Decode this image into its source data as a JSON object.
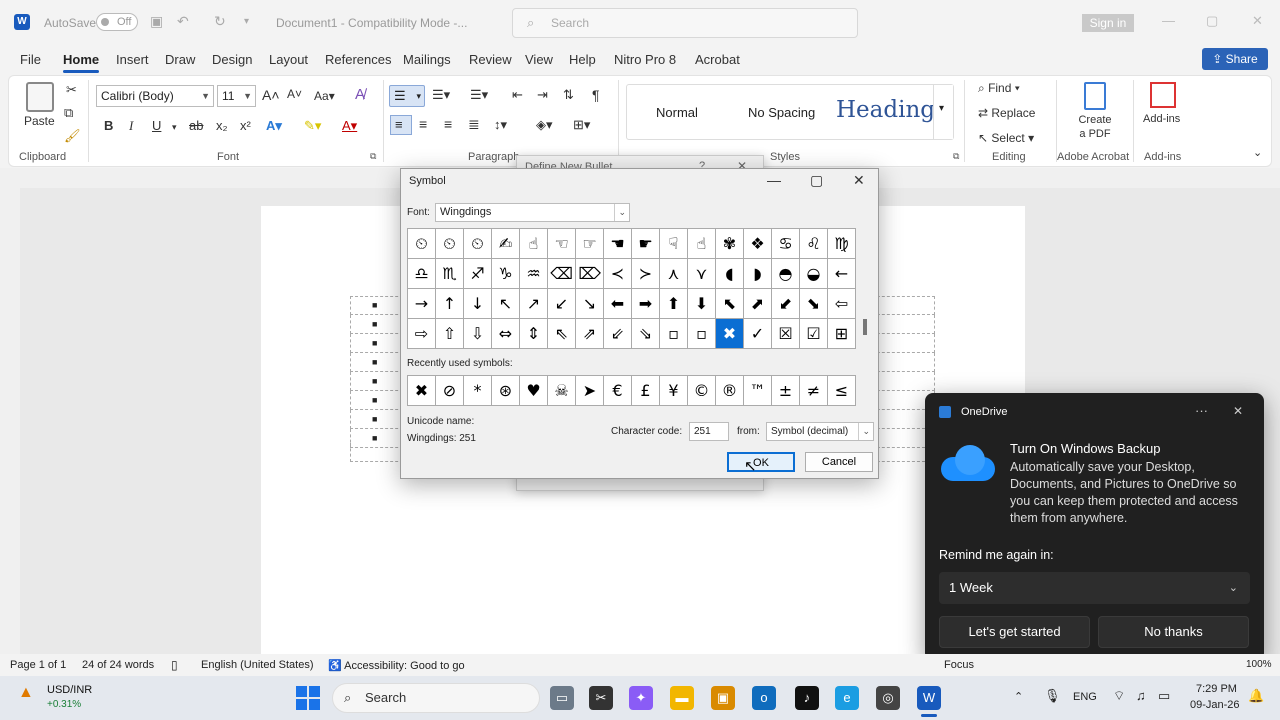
{
  "titlebar": {
    "app_icon": "W",
    "autosave_label": "AutoSave",
    "autosave_state": "Off",
    "doc_title": "Document1 - Compatibility Mode -...",
    "search_placeholder": "Search",
    "signin_label": "Sign in"
  },
  "menu": {
    "items": [
      "File",
      "Home",
      "Insert",
      "Draw",
      "Design",
      "Layout",
      "References",
      "Mailings",
      "Review",
      "View",
      "Help",
      "Nitro Pro 8",
      "Acrobat"
    ],
    "share_label": "Share"
  },
  "ribbon": {
    "clipboard": {
      "paste_label": "Paste",
      "group_label": "Clipboard"
    },
    "font": {
      "font_name": "Calibri (Body)",
      "font_size": "11",
      "group_label": "Font",
      "case_label": "Aa"
    },
    "paragraph": {
      "group_label": "Paragraph"
    },
    "styles": {
      "normal": "Normal",
      "no_spacing": "No Spacing",
      "heading": "Heading",
      "group_label": "Styles"
    },
    "editing": {
      "find": "Find",
      "replace": "Replace",
      "select": "Select",
      "group_label": "Editing"
    },
    "acrobat": {
      "create_pdf": "Create a PDF",
      "group_label": "Adobe Acrobat"
    },
    "addins": {
      "label": "Add-ins",
      "group_label": "Add-ins"
    }
  },
  "behind_dialog": {
    "title": "Define New Bullet",
    "help": "?"
  },
  "symbol_dialog": {
    "title": "Symbol",
    "font_label": "Font:",
    "font_value": "Wingdings",
    "symbols": [
      "⏲",
      "⏲",
      "⏲",
      "✍",
      "☝",
      "☜",
      "☞",
      "☚",
      "☛",
      "☟",
      "☝",
      "✾",
      "❖",
      "♋",
      "♌",
      "♍",
      "♎",
      "♏",
      "♐",
      "♑",
      "♒",
      "⌫",
      "⌦",
      "≺",
      "≻",
      "⋏",
      "⋎",
      "◖",
      "◗",
      "◓",
      "◒",
      "←",
      "→",
      "↑",
      "↓",
      "↖",
      "↗",
      "↙",
      "↘",
      "⬅",
      "➡",
      "⬆",
      "⬇",
      "⬉",
      "⬈",
      "⬋",
      "⬊",
      "⇦",
      "⇨",
      "⇧",
      "⇩",
      "⇔",
      "⇕",
      "⇖",
      "⇗",
      "⇙",
      "⇘",
      "▫",
      "▫",
      "✖",
      "✓",
      "☒",
      "☑",
      "⊞"
    ],
    "selected_index": 59,
    "recent_label": "Recently used symbols:",
    "recent": [
      "✖",
      "⊘",
      "*",
      "⊛",
      "♥",
      "☠",
      "➤",
      "€",
      "£",
      "¥",
      "©",
      "®",
      "™",
      "±",
      "≠",
      "≤"
    ],
    "unicode_name_label": "Unicode name:",
    "unicode_name_value": "Wingdings: 251",
    "char_code_label": "Character code:",
    "char_code_value": "251",
    "from_label": "from:",
    "from_value": "Symbol (decimal)",
    "ok_label": "OK",
    "cancel_label": "Cancel"
  },
  "onedrive": {
    "title": "OneDrive",
    "heading": "Turn On Windows Backup",
    "body": "Automatically save your Desktop, Documents, and Pictures to OneDrive so you can keep them protected and access them from anywhere.",
    "remind_label": "Remind me again in:",
    "remind_value": "1 Week",
    "primary_button": "Let's get started",
    "secondary_button": "No thanks"
  },
  "statusbar": {
    "page": "Page 1 of 1",
    "words": "24 of 24 words",
    "language": "English (United States)",
    "accessibility": "Accessibility: Good to go",
    "focus": "Focus",
    "zoom": "100%"
  },
  "taskbar": {
    "ticker_name": "USD/INR",
    "ticker_change": "+0.31%",
    "search_label": "Search",
    "lang": "ENG",
    "time": "7:29 PM",
    "date": "09-Jan-26"
  },
  "colors": {
    "word_blue": "#185abd",
    "selected_symbol": "#0b6ed3",
    "onedrive_bg": "#202020"
  }
}
